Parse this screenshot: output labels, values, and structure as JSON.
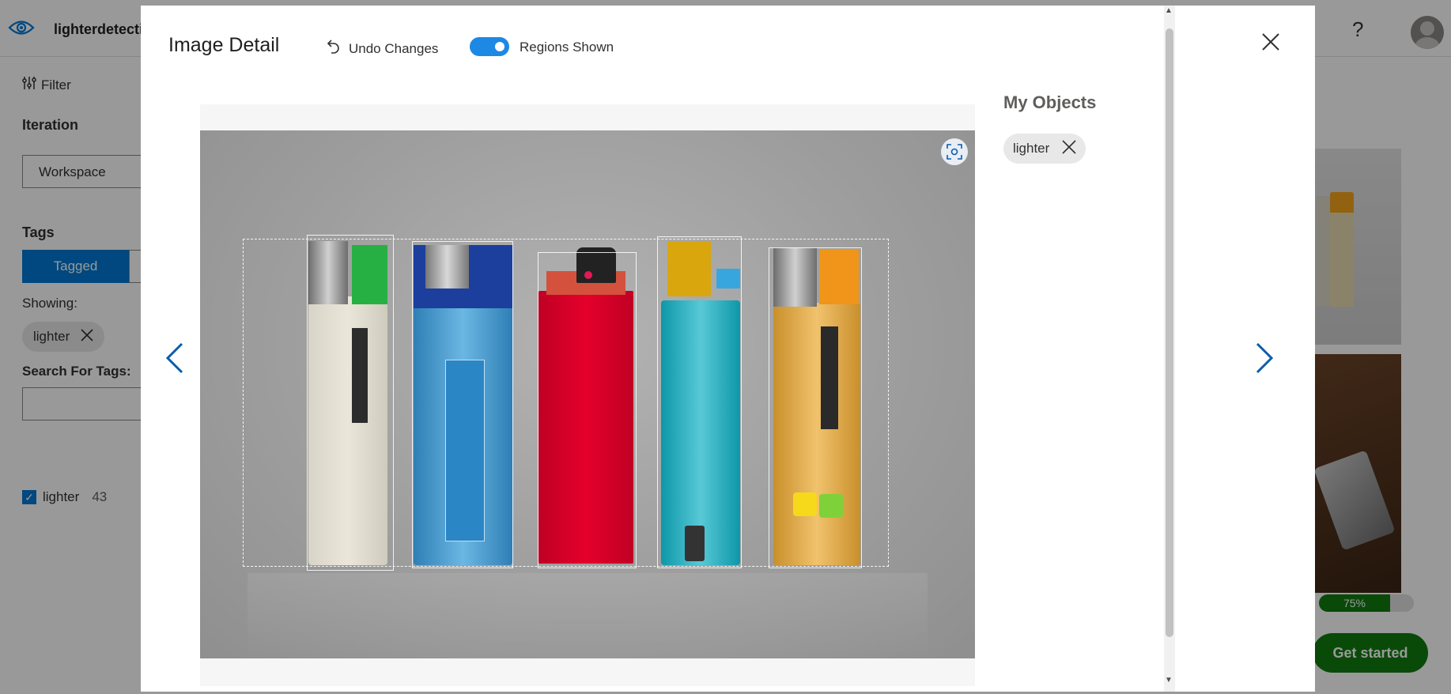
{
  "app": {
    "name": "lighterdetecti",
    "help_label": "?"
  },
  "sidebar": {
    "filter_label": "Filter",
    "iteration_label": "Iteration",
    "iteration_value": "Workspace",
    "tags_label": "Tags",
    "tagged_label": "Tagged",
    "showing_label": "Showing:",
    "showing_chip": "lighter",
    "search_label": "Search For Tags:",
    "search_value": "",
    "tag_list": [
      {
        "name": "lighter",
        "count": "43",
        "checked": true
      }
    ]
  },
  "background": {
    "progress_label": "75%",
    "progress_value": 0.75,
    "get_started_label": "Get started"
  },
  "modal": {
    "title": "Image Detail",
    "undo_label": "Undo Changes",
    "regions_label": "Regions Shown",
    "regions_enabled": true,
    "objects_title": "My Objects",
    "objects": [
      {
        "name": "lighter"
      }
    ]
  },
  "colors": {
    "accent": "#0078d4",
    "toggle_on": "#1e88e5",
    "success": "#107c10"
  },
  "icons": {
    "eye": "eye-icon",
    "filter": "filter-sliders-icon",
    "undo": "undo-arrow-icon",
    "close": "close-icon",
    "prev": "chevron-left-icon",
    "next": "chevron-right-icon",
    "focus": "focus-frame-icon"
  }
}
